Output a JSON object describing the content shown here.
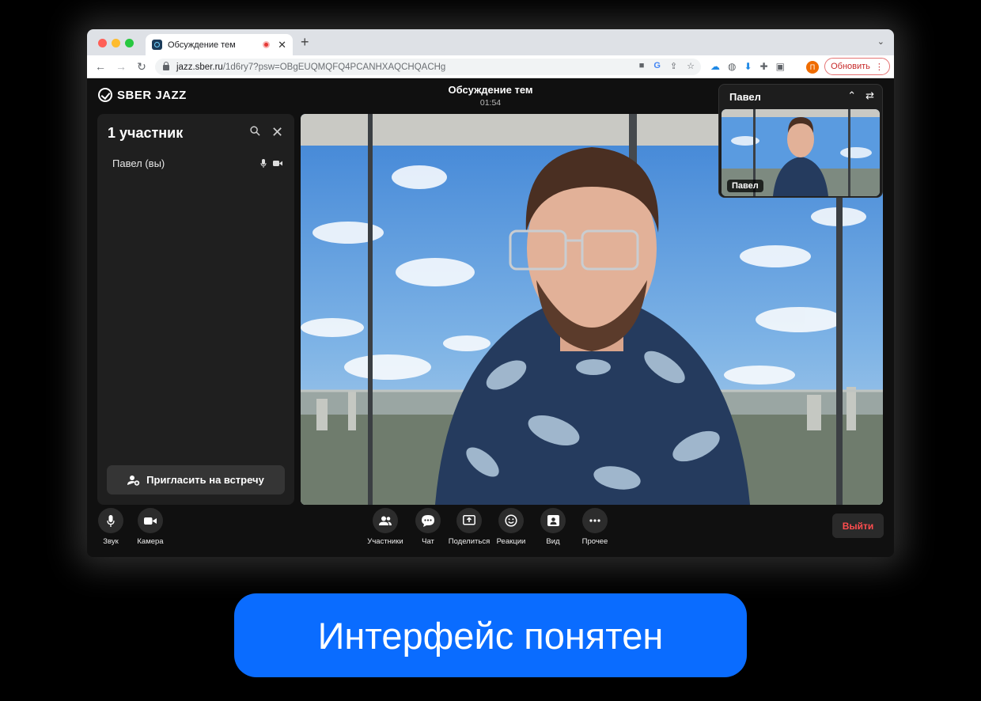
{
  "browser": {
    "tab_title": "Обсуждение тем",
    "url_host": "jazz.sber.ru",
    "url_path": "/1d6ry7?psw=OBgEUQMQFQ4PCANHXAQCHQACHg",
    "profile_initial": "П",
    "update_label": "Обновить"
  },
  "app": {
    "logo_text": "SBER JAZZ",
    "meeting_title": "Обсуждение тем",
    "meeting_timer": "01:54"
  },
  "participants": {
    "heading": "1 участник",
    "list": [
      {
        "name": "Павел (вы)"
      }
    ],
    "invite_label": "Пригласить на встречу"
  },
  "pip": {
    "name": "Павел",
    "label": "Павел"
  },
  "controls": {
    "sound": "Звук",
    "camera": "Камера",
    "participants": "Участники",
    "chat": "Чат",
    "share": "Поделиться",
    "reactions": "Реакции",
    "view": "Вид",
    "more": "Прочее",
    "leave": "Выйти"
  },
  "promo": {
    "text": "Интерфейс понятен"
  },
  "colors": {
    "accent": "#0a6cff",
    "leave": "#ff4d4f",
    "panel": "#1f1f1f",
    "app_bg": "#101010"
  }
}
